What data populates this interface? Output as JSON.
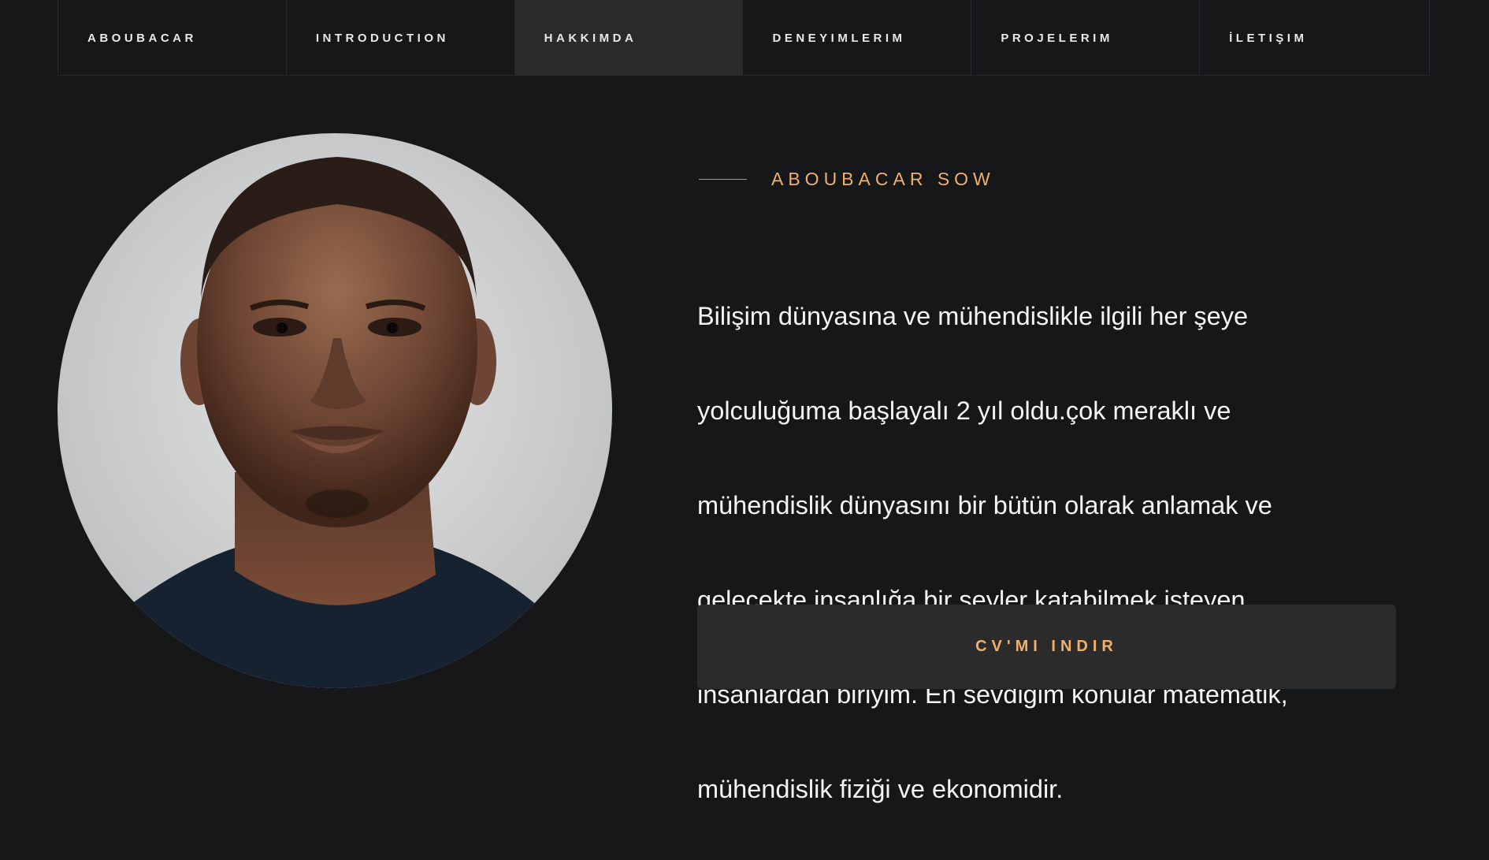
{
  "nav": {
    "items": [
      {
        "label": "ABOUBACAR",
        "active": false
      },
      {
        "label": "INTRODUCTION",
        "active": false
      },
      {
        "label": "HAKKIMDA",
        "active": true
      },
      {
        "label": "DENEYIMLERIM",
        "active": false
      },
      {
        "label": "PROJELERIM",
        "active": false
      },
      {
        "label": "İLETIŞIM",
        "active": false
      }
    ]
  },
  "about": {
    "name": "ABOUBACAR SOW",
    "bio_lines": [
      "Bilişim dünyasına ve mühendislikle ilgili her şeye",
      "yolculuğuma başlayalı 2 yıl oldu.çok meraklı ve",
      "mühendislik dünyasını bir bütün olarak anlamak ve",
      "gelecekte insanlığa bir şeyler katabilmek isteyen",
      "insanlardan biriyim. En sevdiğim konular matematik,",
      "mühendislik fiziği ve ekonomidir."
    ],
    "cv_button_label": "CV'MI INDIR"
  },
  "colors": {
    "background": "#161719",
    "nav_active_bg": "#2a2a2b",
    "accent": "#efb06c",
    "button_bg": "#2b2b2c",
    "text": "#f5f5f5"
  },
  "icons": {
    "profile_photo": "portrait-photo"
  }
}
